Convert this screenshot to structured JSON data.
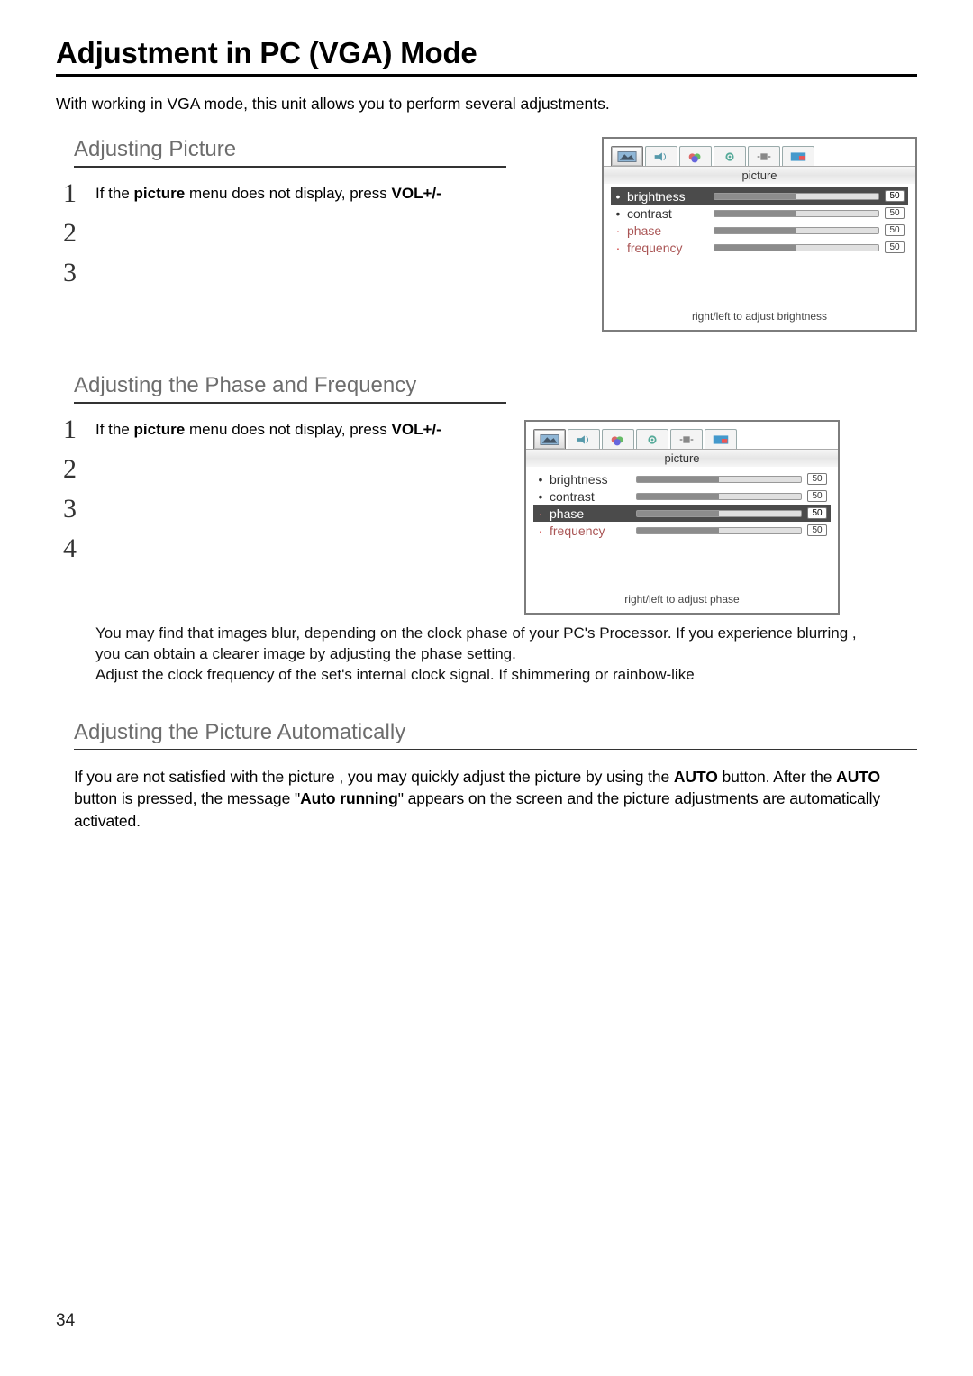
{
  "page_title": "Adjustment in PC (VGA) Mode",
  "intro": "With working in VGA mode, this unit allows you to perform several adjustments.",
  "sec1": {
    "heading": "Adjusting Picture",
    "step1": {
      "num": "1",
      "pre": "If the ",
      "b1": "picture",
      "mid": " menu does not display, press ",
      "b2": "VOL+/-"
    },
    "step2": {
      "num": "2",
      "txt": ""
    },
    "step3": {
      "num": "3",
      "txt": ""
    },
    "osd": {
      "tabname": "picture",
      "rows": [
        {
          "bullet": "•",
          "label": "brightness",
          "value": "50",
          "selected": true
        },
        {
          "bullet": "•",
          "label": "contrast",
          "value": "50",
          "selected": false
        },
        {
          "bullet": "·",
          "label": "phase",
          "value": "50",
          "selected": false,
          "muted": true
        },
        {
          "bullet": "·",
          "label": "frequency",
          "value": "50",
          "selected": false,
          "muted": true
        }
      ],
      "hint": "right/left to adjust brightness"
    }
  },
  "sec2": {
    "heading": "Adjusting the Phase and Frequency",
    "step1": {
      "num": "1",
      "pre": "If the ",
      "b1": "picture",
      "mid": " menu does not display, press ",
      "b2": "VOL+/-"
    },
    "step2": {
      "num": "2",
      "txt": ""
    },
    "step3": {
      "num": "3",
      "txt": ""
    },
    "step4": {
      "num": "4",
      "txt": ""
    },
    "osd": {
      "tabname": "picture",
      "rows": [
        {
          "bullet": "•",
          "label": "brightness",
          "value": "50",
          "selected": false
        },
        {
          "bullet": "•",
          "label": "contrast",
          "value": "50",
          "selected": false
        },
        {
          "bullet": "·",
          "label": "phase",
          "value": "50",
          "selected": true
        },
        {
          "bullet": "·",
          "label": "frequency",
          "value": "50",
          "selected": false,
          "muted": true
        }
      ],
      "hint": "right/left to adjust phase"
    },
    "note1": "You may find that images blur, depending on the clock phase of your PC's Processor. If you experience blurring ,",
    "note2": "you can obtain a clearer image by adjusting the phase setting.",
    "note3": "Adjust the clock frequency of the set's internal clock signal. If shimmering or rainbow-like"
  },
  "sec3": {
    "heading": "Adjusting the Picture Automatically",
    "p_pre": "If you are not satisfied with the picture , you may quickly adjust the picture by using the ",
    "p_b1": "AUTO",
    "p_mid": " button.\nAfter the ",
    "p_b2": "AUTO",
    "p_mid2": " button is pressed, the message \"",
    "p_b3": "Auto running",
    "p_post": "\" appears on the screen and the picture adjustments are automatically activated."
  },
  "page_number": "34",
  "icons": {
    "tab1": "picture",
    "tab2": "sound",
    "tab3": "color",
    "tab4": "settings",
    "tab5": "geometry",
    "tab6": "pip"
  }
}
